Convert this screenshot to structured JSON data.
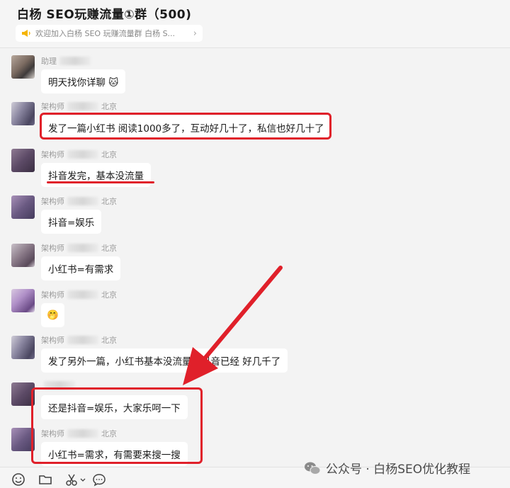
{
  "header": {
    "title": "白杨 SEO玩赚流量①群（500)",
    "notice": "欢迎加入白杨 SEO 玩赚流量群 白杨 S..."
  },
  "messages": [
    {
      "sender": "助理",
      "location": "",
      "text": "明天找你详聊 🐱"
    },
    {
      "sender": "架构师",
      "location": "北京",
      "text": "发了一篇小红书 阅读1000多了，互动好几十了，私信也好几十了"
    },
    {
      "sender": "架构师",
      "location": "北京",
      "text": "抖音发完，基本没流量"
    },
    {
      "sender": "架构师",
      "location": "北京",
      "text": "抖音=娱乐"
    },
    {
      "sender": "架构师",
      "location": "北京",
      "text": "小红书=有需求"
    },
    {
      "sender": "架构师",
      "location": "北京",
      "text": "🤭"
    },
    {
      "sender": "架构师",
      "location": "北京",
      "text": "发了另外一篇，小红书基本没流量，抖音已经 好几千了"
    },
    {
      "sender": "",
      "location": "",
      "text": "还是抖音=娱乐，大家乐呵一下"
    },
    {
      "sender": "架构师",
      "location": "北京",
      "text": "小红书=需求，有需要来搜一搜"
    }
  ],
  "toolbar": {
    "icons": [
      "emoji-icon",
      "folder-icon",
      "scissors-icon",
      "chat-bubble-icon"
    ]
  },
  "watermark": "公众号 · 白杨SEO优化教程",
  "colors": {
    "highlight": "#e0202a",
    "bubble": "#ffffff",
    "background": "#f3f3f3"
  }
}
